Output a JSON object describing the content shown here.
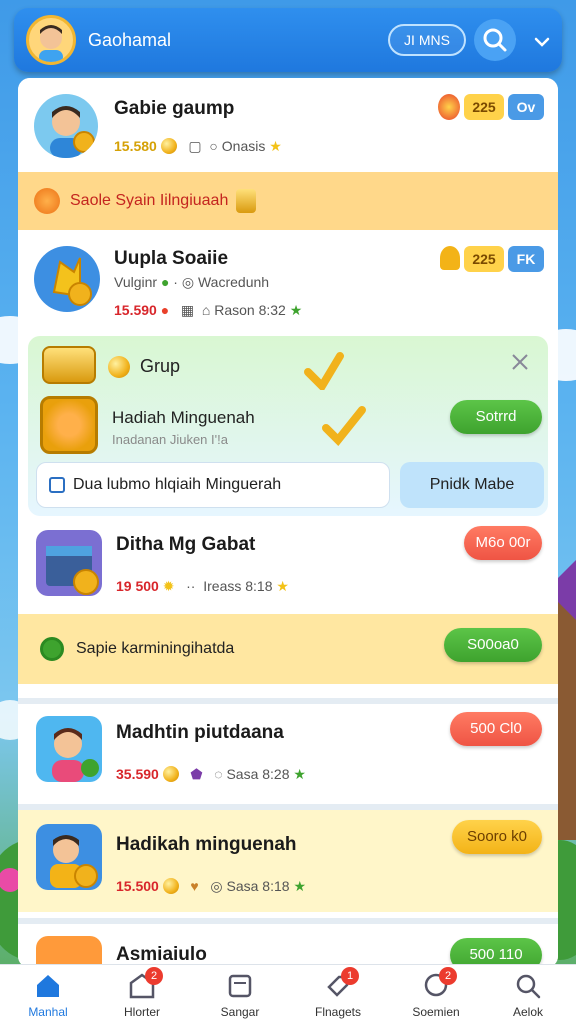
{
  "header": {
    "title": "Gaohamal",
    "pill_label": "JI MNS",
    "avatar_icon": "user-avatar",
    "search_icon": "search-icon",
    "menu_icon": "chevron-down-icon"
  },
  "rows": [
    {
      "name": "Gabie gaump",
      "amount": "15.580",
      "meta_text": "Onasis",
      "badge_count": "225",
      "badge_tag": "Ov"
    },
    {
      "name": "Uupla Soaiie",
      "sub": "Vulginr",
      "sub2": "Wacredunh",
      "amount": "15.590",
      "meta_text": "Rason 8:32",
      "badge_count": "225",
      "badge_tag": "FK"
    },
    {
      "name": "Ditha Mg Gabat",
      "amount": "19 500",
      "meta_text": "Ireass 8:18",
      "button": "M6o 00r"
    },
    {
      "name": "Madhtin piutdaana",
      "amount": "35.590",
      "meta_text": "Sasa 8:28",
      "button": "500 Cl0"
    },
    {
      "name": "Hadikah minguenah",
      "amount": "15.500",
      "meta_text": "Sasa 8:18",
      "button": "Sooro k0"
    },
    {
      "name": "Asmiaiulo",
      "button": "500 110"
    }
  ],
  "banners": {
    "first": "Saole Syain Iilngiuaah",
    "second": "Sapie karminingihatda",
    "second_button": "S00oa0"
  },
  "grup": {
    "title": "Grup",
    "reward_title": "Hadiah Minguenah",
    "reward_sub": "Inadanan Jiuken I'!a",
    "reward_button": "Sotrrd",
    "dialog_text": "Dua lubmo hlqiaih Minguerah",
    "dialog_button": "Pnidk Mabe"
  },
  "nav": [
    {
      "label": "Manhal",
      "icon": "home-icon",
      "active": true
    },
    {
      "label": "Hlorter",
      "icon": "shop-icon",
      "badge": "2"
    },
    {
      "label": "Sangar",
      "icon": "inbox-icon"
    },
    {
      "label": "Flnagets",
      "icon": "tag-icon",
      "badge": "1"
    },
    {
      "label": "Soemien",
      "icon": "chat-icon",
      "badge": "2"
    },
    {
      "label": "Aelok",
      "icon": "search-icon"
    }
  ],
  "colors": {
    "primary": "#1f78de",
    "green": "#3ea32e",
    "red": "#ef5444",
    "gold": "#f3b317"
  }
}
